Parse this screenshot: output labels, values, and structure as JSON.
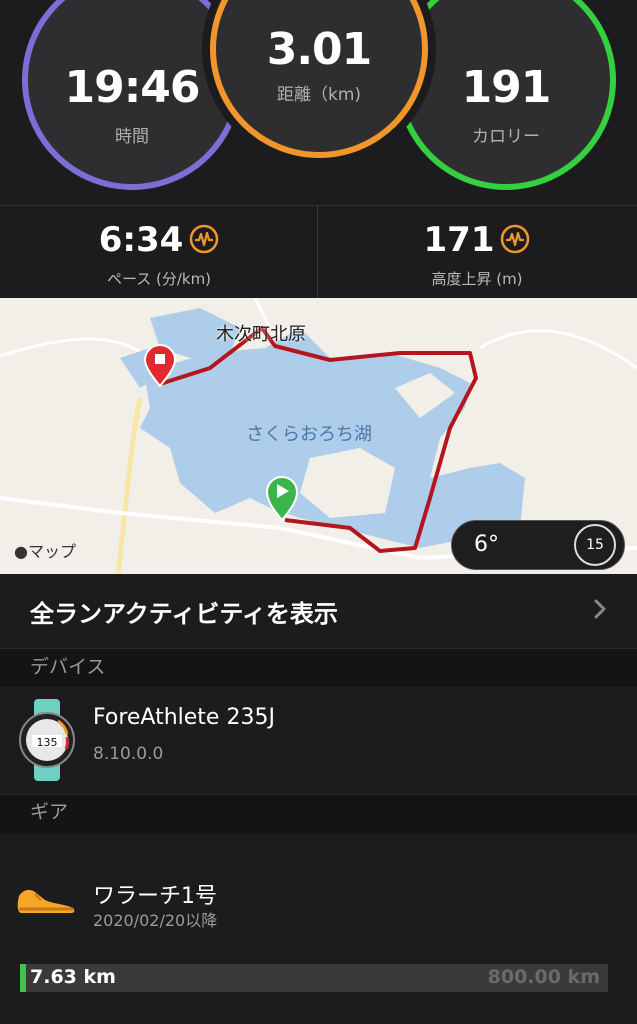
{
  "summary": {
    "time": {
      "value": "19:46",
      "label": "時間",
      "color": "#7b6fd6"
    },
    "distance": {
      "value": "3.01",
      "label": "距離（km)",
      "color": "#f0962a"
    },
    "calories": {
      "value": "191",
      "label": "カロリー",
      "color": "#35d03f"
    }
  },
  "stats": {
    "pace": {
      "value": "6:34",
      "label": "ペース (分/km)",
      "icon": "pulse-icon"
    },
    "elevation": {
      "value": "171",
      "label": "高度上昇 (m)",
      "icon": "pulse-icon"
    }
  },
  "map": {
    "town_label": "木次町北原",
    "lake_label": "さくらおろち湖",
    "attribution": "マップ",
    "weather": {
      "temp": "6°",
      "wind": "15"
    },
    "start_marker": "play-icon",
    "end_marker": "stop-icon"
  },
  "all_runs": {
    "label": "全ランアクティビティを表示"
  },
  "devices": {
    "header": "デバイス",
    "name": "ForeAthlete 235J",
    "firmware": "8.10.0.0",
    "watch_face_value": "135"
  },
  "gear": {
    "header": "ギア",
    "name": "ワラーチ1号",
    "since": "2020/02/20以降",
    "distance": "7.63 km",
    "max": "800.00 km",
    "progress_fraction": 0.0095
  }
}
